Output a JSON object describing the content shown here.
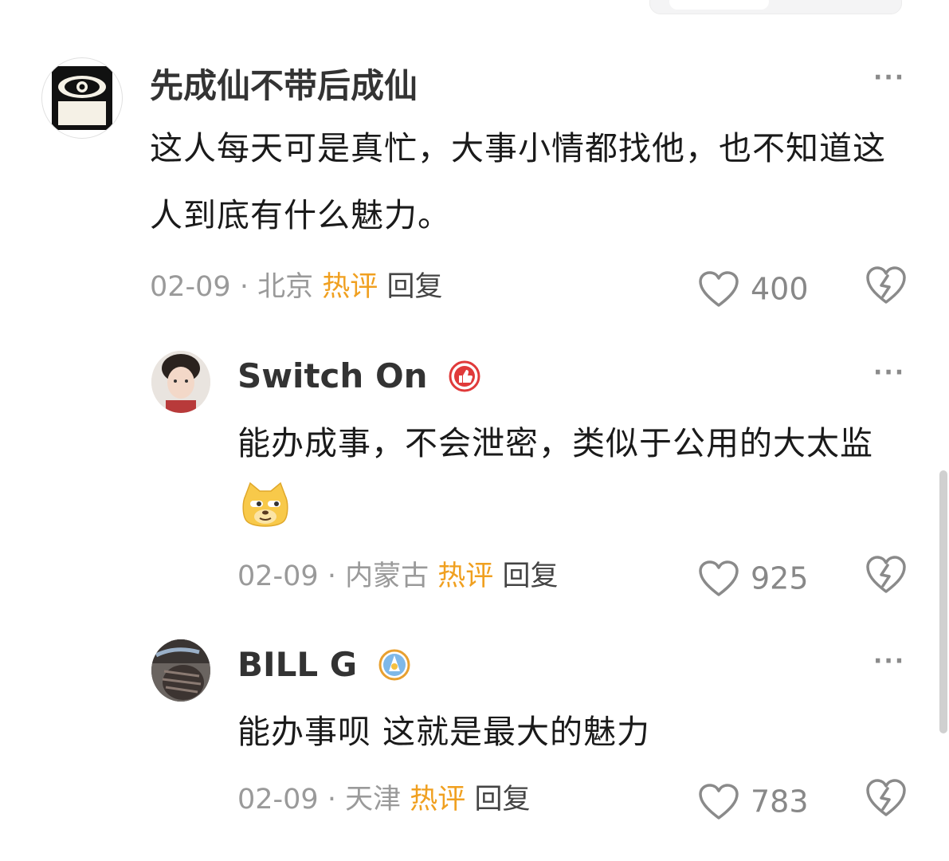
{
  "comments": [
    {
      "username": "先成仙不带后成仙",
      "text": "这人每天可是真忙，大事小情都找他，也不知道这人到底有什么魅力。",
      "date": "02-09",
      "separator": "·",
      "location": "北京",
      "hot_tag": "热评",
      "reply_label": "回复",
      "likes": "400"
    },
    {
      "username": "Switch On",
      "text": "能办成事，不会泄密，类似于公用的大太监",
      "emoji": "doge-emoji",
      "date": "02-09",
      "separator": "·",
      "location": "内蒙古",
      "hot_tag": "热评",
      "reply_label": "回复",
      "likes": "925"
    },
    {
      "username": "BILL G",
      "text": "能办事呗 这就是最大的魅力",
      "date": "02-09",
      "separator": "·",
      "location": "天津",
      "hot_tag": "热评",
      "reply_label": "回复",
      "likes": "783"
    }
  ],
  "more_label": "···",
  "colors": {
    "hot_tag": "#f0a020",
    "meta": "#9a9a9a",
    "username": "#333333",
    "text": "#1a1a1a",
    "badge_red": "#e03a3a"
  }
}
